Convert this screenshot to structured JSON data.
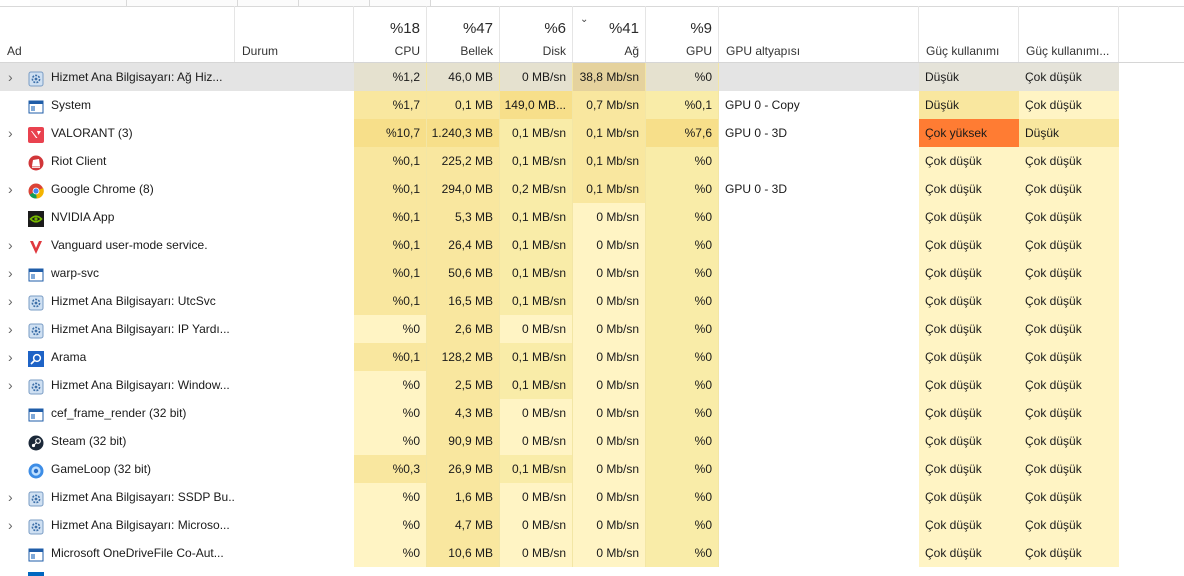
{
  "columns": {
    "name": {
      "label": "Ad"
    },
    "status": {
      "label": "Durum"
    },
    "cpu": {
      "pct": "%18",
      "label": "CPU"
    },
    "memory": {
      "pct": "%47",
      "label": "Bellek"
    },
    "disk": {
      "pct": "%6",
      "label": "Disk"
    },
    "network": {
      "pct": "%41",
      "label": "Ağ",
      "sorted": "desc"
    },
    "gpu": {
      "pct": "%9",
      "label": "GPU"
    },
    "gpu_engine": {
      "label": "GPU altyapısı"
    },
    "power": {
      "label": "Güç kullanımı"
    },
    "power_trend": {
      "label": "Güç kullanımı..."
    }
  },
  "colors": {
    "heat_low": "#fff4c4",
    "heat_mid": "#f9e79f",
    "heat_high": "#f7df8a",
    "power_very_high": "#ff7c33",
    "selected_row": "#e4e4e4"
  },
  "processes": [
    {
      "name": "Hizmet Ana Bilgisayarı: Ağ Hiz...",
      "icon": "gear-icon",
      "expandable": true,
      "selected": true,
      "cpu": "%1,2",
      "mem": "46,0 MB",
      "disk": "0 MB/sn",
      "net": "38,8 Mb/sn",
      "gpu": "%0",
      "gpu_engine": "",
      "power": "Düşük",
      "power_trend": "Çok düşük"
    },
    {
      "name": "System",
      "icon": "system-window-icon",
      "expandable": false,
      "cpu": "%1,7",
      "mem": "0,1 MB",
      "disk": "149,0 MB...",
      "net": "0,7 Mb/sn",
      "gpu": "%0,1",
      "gpu_engine": "GPU 0 - Copy",
      "power": "Düşük",
      "power_trend": "Çok düşük"
    },
    {
      "name": "VALORANT (3)",
      "icon": "valorant-icon",
      "expandable": true,
      "cpu": "%10,7",
      "mem": "1.240,3 MB",
      "disk": "0,1 MB/sn",
      "net": "0,1 Mb/sn",
      "gpu": "%7,6",
      "gpu_engine": "GPU 0 - 3D",
      "power": "Çok yüksek",
      "power_trend": "Düşük"
    },
    {
      "name": "Riot Client",
      "icon": "riot-client-icon",
      "expandable": false,
      "cpu": "%0,1",
      "mem": "225,2 MB",
      "disk": "0,1 MB/sn",
      "net": "0,1 Mb/sn",
      "gpu": "%0",
      "gpu_engine": "",
      "power": "Çok düşük",
      "power_trend": "Çok düşük"
    },
    {
      "name": "Google Chrome (8)",
      "icon": "chrome-icon",
      "expandable": true,
      "cpu": "%0,1",
      "mem": "294,0 MB",
      "disk": "0,2 MB/sn",
      "net": "0,1 Mb/sn",
      "gpu": "%0",
      "gpu_engine": "GPU 0 - 3D",
      "power": "Çok düşük",
      "power_trend": "Çok düşük"
    },
    {
      "name": "NVIDIA App",
      "icon": "nvidia-icon",
      "expandable": false,
      "cpu": "%0,1",
      "mem": "5,3 MB",
      "disk": "0,1 MB/sn",
      "net": "0 Mb/sn",
      "gpu": "%0",
      "gpu_engine": "",
      "power": "Çok düşük",
      "power_trend": "Çok düşük"
    },
    {
      "name": "Vanguard user-mode service.",
      "icon": "vanguard-icon",
      "expandable": true,
      "cpu": "%0,1",
      "mem": "26,4 MB",
      "disk": "0,1 MB/sn",
      "net": "0 Mb/sn",
      "gpu": "%0",
      "gpu_engine": "",
      "power": "Çok düşük",
      "power_trend": "Çok düşük"
    },
    {
      "name": "warp-svc",
      "icon": "system-window-icon",
      "expandable": true,
      "cpu": "%0,1",
      "mem": "50,6 MB",
      "disk": "0,1 MB/sn",
      "net": "0 Mb/sn",
      "gpu": "%0",
      "gpu_engine": "",
      "power": "Çok düşük",
      "power_trend": "Çok düşük"
    },
    {
      "name": "Hizmet Ana Bilgisayarı: UtcSvc",
      "icon": "gear-icon",
      "expandable": true,
      "cpu": "%0,1",
      "mem": "16,5 MB",
      "disk": "0,1 MB/sn",
      "net": "0 Mb/sn",
      "gpu": "%0",
      "gpu_engine": "",
      "power": "Çok düşük",
      "power_trend": "Çok düşük"
    },
    {
      "name": "Hizmet Ana Bilgisayarı: IP Yardı...",
      "icon": "gear-icon",
      "expandable": true,
      "cpu": "%0",
      "mem": "2,6 MB",
      "disk": "0 MB/sn",
      "net": "0 Mb/sn",
      "gpu": "%0",
      "gpu_engine": "",
      "power": "Çok düşük",
      "power_trend": "Çok düşük"
    },
    {
      "name": "Arama",
      "icon": "search-icon",
      "expandable": true,
      "cpu": "%0,1",
      "mem": "128,2 MB",
      "disk": "0,1 MB/sn",
      "net": "0 Mb/sn",
      "gpu": "%0",
      "gpu_engine": "",
      "power": "Çok düşük",
      "power_trend": "Çok düşük"
    },
    {
      "name": "Hizmet Ana Bilgisayarı: Window...",
      "icon": "gear-icon",
      "expandable": true,
      "cpu": "%0",
      "mem": "2,5 MB",
      "disk": "0,1 MB/sn",
      "net": "0 Mb/sn",
      "gpu": "%0",
      "gpu_engine": "",
      "power": "Çok düşük",
      "power_trend": "Çok düşük"
    },
    {
      "name": "cef_frame_render (32 bit)",
      "icon": "system-window-icon",
      "expandable": false,
      "cpu": "%0",
      "mem": "4,3 MB",
      "disk": "0 MB/sn",
      "net": "0 Mb/sn",
      "gpu": "%0",
      "gpu_engine": "",
      "power": "Çok düşük",
      "power_trend": "Çok düşük"
    },
    {
      "name": "Steam (32 bit)",
      "icon": "steam-icon",
      "expandable": false,
      "cpu": "%0",
      "mem": "90,9 MB",
      "disk": "0 MB/sn",
      "net": "0 Mb/sn",
      "gpu": "%0",
      "gpu_engine": "",
      "power": "Çok düşük",
      "power_trend": "Çok düşük"
    },
    {
      "name": "GameLoop (32 bit)",
      "icon": "gameloop-icon",
      "expandable": false,
      "cpu": "%0,3",
      "mem": "26,9 MB",
      "disk": "0,1 MB/sn",
      "net": "0 Mb/sn",
      "gpu": "%0",
      "gpu_engine": "",
      "power": "Çok düşük",
      "power_trend": "Çok düşük"
    },
    {
      "name": "Hizmet Ana Bilgisayarı: SSDP Bu...",
      "icon": "gear-icon",
      "expandable": true,
      "cpu": "%0",
      "mem": "1,6 MB",
      "disk": "0 MB/sn",
      "net": "0 Mb/sn",
      "gpu": "%0",
      "gpu_engine": "",
      "power": "Çok düşük",
      "power_trend": "Çok düşük"
    },
    {
      "name": "Hizmet Ana Bilgisayarı: Microso...",
      "icon": "gear-icon",
      "expandable": true,
      "cpu": "%0",
      "mem": "4,7 MB",
      "disk": "0 MB/sn",
      "net": "0 Mb/sn",
      "gpu": "%0",
      "gpu_engine": "",
      "power": "Çok düşük",
      "power_trend": "Çok düşük"
    },
    {
      "name": "Microsoft OneDriveFile Co-Aut...",
      "icon": "system-window-icon",
      "expandable": false,
      "cpu": "%0",
      "mem": "10,6 MB",
      "disk": "0 MB/sn",
      "net": "0 Mb/sn",
      "gpu": "%0",
      "gpu_engine": "",
      "power": "Çok düşük",
      "power_trend": "Çok düşük"
    }
  ]
}
